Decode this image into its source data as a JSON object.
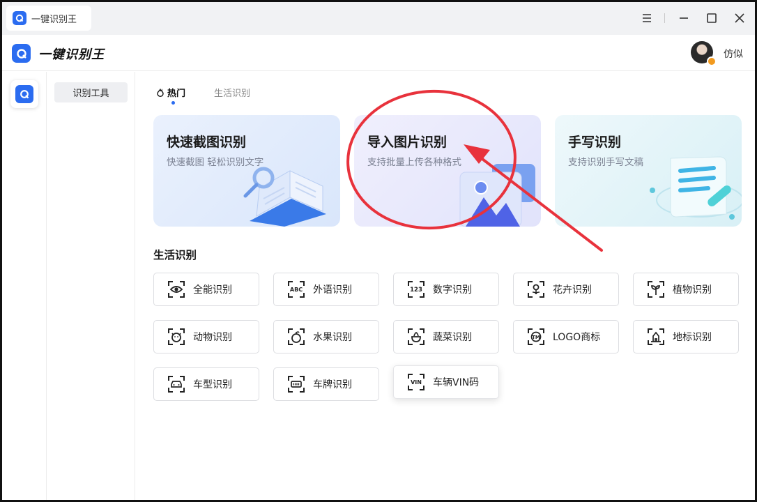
{
  "window": {
    "tab_title": "一键识别王",
    "controls": [
      "menu-icon",
      "minimize-icon",
      "maximize-icon",
      "close-icon"
    ]
  },
  "header": {
    "brand_title": "一键识别王",
    "username": "仿似"
  },
  "sidebar": {
    "items": [
      {
        "label": "识别工具",
        "active": true
      }
    ]
  },
  "tabs": [
    {
      "label": "热门",
      "icon": "flame-icon",
      "active": true
    },
    {
      "label": "生活识别",
      "active": false
    }
  ],
  "cards": [
    {
      "title": "快速截图识别",
      "subtitle": "快速截图 轻松识别文字",
      "icon": "book-magnifier-illustration"
    },
    {
      "title": "导入图片识别",
      "subtitle": "支持批量上传各种格式",
      "icon": "image-stack-illustration"
    },
    {
      "title": "手写识别",
      "subtitle": "支持识别手写文稿",
      "icon": "scroll-pen-illustration"
    }
  ],
  "section": {
    "title": "生活识别"
  },
  "tools": [
    {
      "label": "全能识别",
      "icon": "eye-scan-icon"
    },
    {
      "label": "外语识别",
      "icon": "abc-scan-icon"
    },
    {
      "label": "数字识别",
      "icon": "number-scan-icon"
    },
    {
      "label": "花卉识别",
      "icon": "flower-scan-icon"
    },
    {
      "label": "植物识别",
      "icon": "plant-scan-icon"
    },
    {
      "label": "动物识别",
      "icon": "animal-scan-icon"
    },
    {
      "label": "水果识别",
      "icon": "fruit-scan-icon"
    },
    {
      "label": "蔬菜识别",
      "icon": "vegetable-scan-icon"
    },
    {
      "label": "LOGO商标",
      "icon": "tm-scan-icon"
    },
    {
      "label": "地标识别",
      "icon": "landmark-scan-icon"
    },
    {
      "label": "车型识别",
      "icon": "car-scan-icon"
    },
    {
      "label": "车牌识别",
      "icon": "license-plate-scan-icon"
    },
    {
      "label": "车辆VIN码",
      "icon": "vin-scan-icon"
    }
  ],
  "colors": {
    "accent": "#2b6cf0",
    "annotation": "#e8323c"
  }
}
